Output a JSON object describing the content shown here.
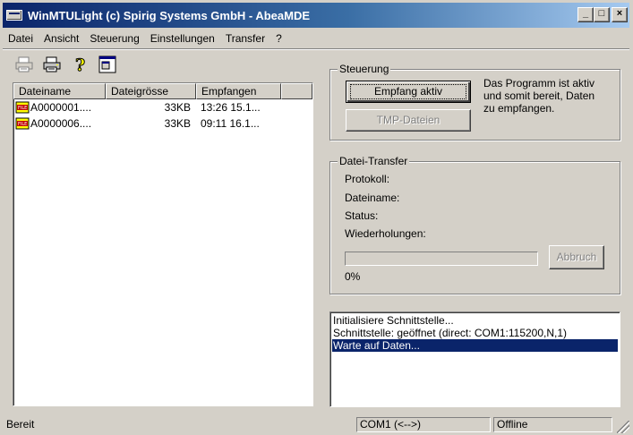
{
  "window": {
    "title": "WinMTULight (c) Spirig Systems GmbH - AbeaMDE",
    "buttons": {
      "minimize": "_",
      "maximize": "□",
      "close": "×"
    }
  },
  "menu": [
    {
      "label": "Datei"
    },
    {
      "label": "Ansicht"
    },
    {
      "label": "Steuerung"
    },
    {
      "label": "Einstellungen"
    },
    {
      "label": "Transfer"
    },
    {
      "label": "?"
    }
  ],
  "toolbar": {
    "icons": [
      "printer-disabled-icon",
      "printer-icon",
      "help-icon",
      "window-icon"
    ]
  },
  "file_list": {
    "columns": [
      "Dateiname",
      "Dateigrösse",
      "Empfangen"
    ],
    "rows": [
      {
        "name": "A0000001....",
        "size": "33KB",
        "received": "13:26 15.1..."
      },
      {
        "name": "A0000006....",
        "size": "33KB",
        "received": "09:11 16.1..."
      }
    ]
  },
  "control": {
    "group_label": "Steuerung",
    "receive_button": "Empfang aktiv",
    "tmp_button": "TMP-Dateien",
    "info": [
      "Das Programm ist aktiv",
      "und somit bereit, Daten",
      "zu empfangen."
    ]
  },
  "transfer": {
    "group_label": "Datei-Transfer",
    "protocol_label": "Protokoll:",
    "filename_label": "Dateiname:",
    "status_label": "Status:",
    "retries_label": "Wiederholungen:",
    "progress_percent": "0%",
    "progress_value": 0,
    "abort_button": "Abbruch"
  },
  "log": {
    "lines": [
      "Initialisiere Schnittstelle...",
      "Schnittstelle: geöffnet (direct: COM1:115200,N,1)",
      "Warte auf Daten..."
    ],
    "selected_index": 2
  },
  "status_bar": {
    "status": "Bereit",
    "port": "COM1 (<-->)",
    "connection": "Offline"
  },
  "colors": {
    "face": "#d4d0c8",
    "title_start": "#0a246a",
    "title_end": "#a6caf0",
    "selection": "#0a246a"
  }
}
